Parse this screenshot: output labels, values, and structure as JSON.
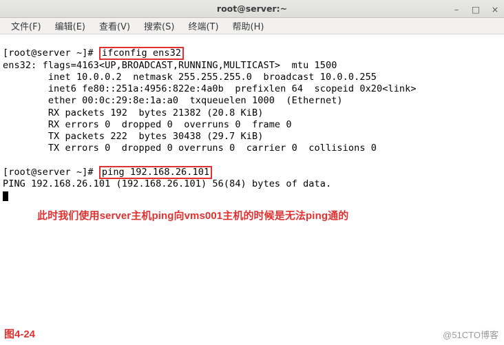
{
  "window": {
    "title": "root@server:~",
    "controls": {
      "min": "–",
      "max": "□",
      "close": "×"
    }
  },
  "menu": {
    "file": "文件(F)",
    "edit": "编辑(E)",
    "view": "查看(V)",
    "search": "搜索(S)",
    "terminal": "终端(T)",
    "help": "帮助(H)"
  },
  "term": {
    "prompt1_pre": "[root@server ~]# ",
    "cmd1": "ifconfig ens32",
    "out1": "ens32: flags=4163<UP,BROADCAST,RUNNING,MULTICAST>  mtu 1500",
    "out2": "        inet 10.0.0.2  netmask 255.255.255.0  broadcast 10.0.0.255",
    "out3": "        inet6 fe80::251a:4956:822e:4a0b  prefixlen 64  scopeid 0x20<link>",
    "out4": "        ether 00:0c:29:8e:1a:a0  txqueuelen 1000  (Ethernet)",
    "out5": "        RX packets 192  bytes 21382 (20.8 KiB)",
    "out6": "        RX errors 0  dropped 0  overruns 0  frame 0",
    "out7": "        TX packets 222  bytes 30438 (29.7 KiB)",
    "out8": "        TX errors 0  dropped 0 overruns 0  carrier 0  collisions 0",
    "blank": "",
    "prompt2_pre": "[root@server ~]# ",
    "cmd2": "ping 192.168.26.101",
    "out9": "PING 192.168.26.101 (192.168.26.101) 56(84) bytes of data."
  },
  "note": "此时我们使用server主机ping向vms001主机的时候是无法ping通的",
  "figure": "图4-24",
  "watermark": "@51CTO博客"
}
